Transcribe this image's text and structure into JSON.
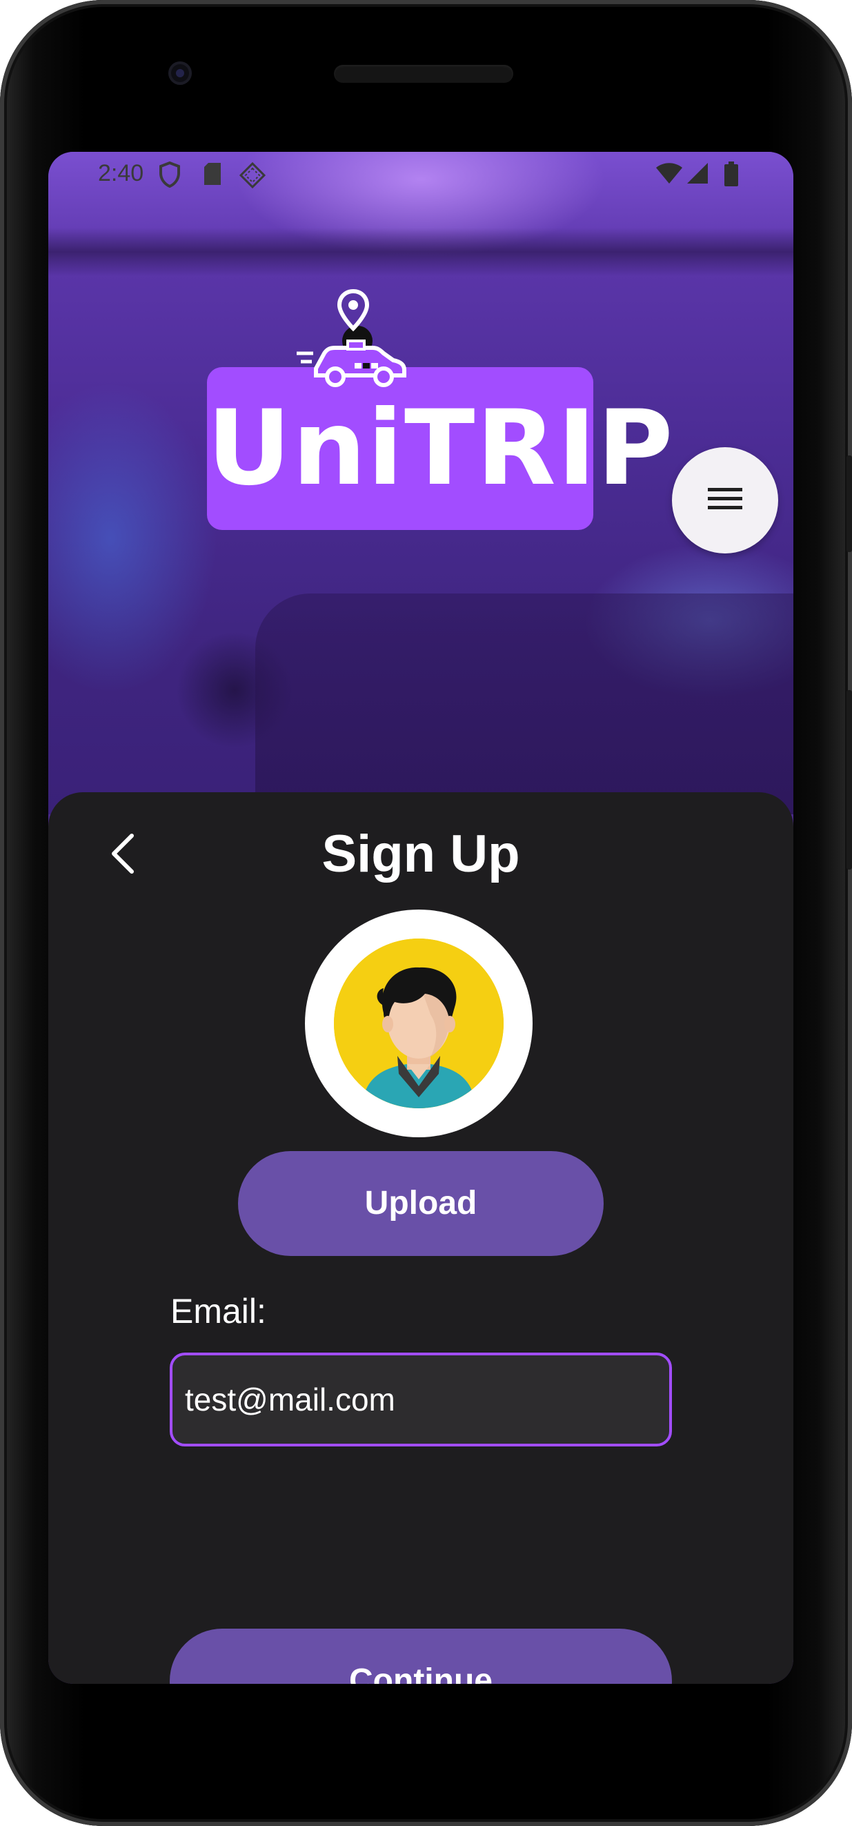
{
  "status_bar": {
    "time": "2:40",
    "icons": [
      "shield-icon",
      "sd-card-icon",
      "data-saver-icon",
      "wifi-icon",
      "signal-icon",
      "battery-icon"
    ]
  },
  "brand": {
    "logo_text": "UniTRIP",
    "logo_icon": "taxi-location-icon",
    "logo_color": "#a24dff"
  },
  "header": {
    "menu_icon": "hamburger-menu-icon"
  },
  "sheet": {
    "title": "Sign Up",
    "back_icon": "chevron-left-icon",
    "avatar": "user-avatar",
    "upload_label": "Upload",
    "email_label": "Email:",
    "email_value": "test@mail.com",
    "continue_label": "Continue"
  },
  "colors": {
    "accent": "#a24dff",
    "button": "#6950a8",
    "sheet_background": "#1e1d1f",
    "input_background": "#2d2c2e",
    "text": "#ffffff"
  }
}
